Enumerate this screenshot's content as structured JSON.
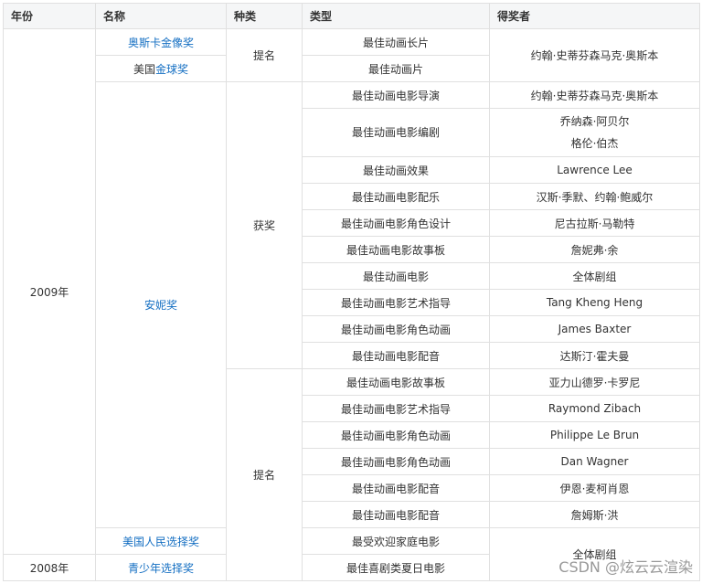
{
  "headers": {
    "year": "年份",
    "name": "名称",
    "kind": "种类",
    "type": "类型",
    "winner": "得奖者"
  },
  "years": {
    "y2009": "2009年",
    "y2008": "2008年"
  },
  "awards": {
    "oscar": "奥斯卡金像奖",
    "golden_globe": "美国金球奖",
    "annie": "安妮奖",
    "peoples_choice": "美国人民选择奖",
    "teen_choice": "青少年选择奖"
  },
  "kinds": {
    "nominated": "提名",
    "won": "获奖"
  },
  "rows": [
    {
      "type": "最佳动画长片"
    },
    {
      "type": "最佳动画片"
    },
    {
      "type": "最佳动画电影导演",
      "winner": "约翰·史蒂芬森马克·奥斯本"
    },
    {
      "type": "最佳动画电影编剧",
      "winner_lines": [
        "乔纳森·阿贝尔",
        "格伦·伯杰"
      ]
    },
    {
      "type": "最佳动画效果",
      "winner": "Lawrence Lee"
    },
    {
      "type": "最佳动画电影配乐",
      "winner": "汉斯·季默、约翰·鲍威尔"
    },
    {
      "type": "最佳动画电影角色设计",
      "winner": "尼古拉斯·马勒特"
    },
    {
      "type": "最佳动画电影故事板",
      "winner": "詹妮弗·余"
    },
    {
      "type": "最佳动画电影",
      "winner": "全体剧组"
    },
    {
      "type": "最佳动画电影艺术指导",
      "winner": "Tang Kheng Heng"
    },
    {
      "type": "最佳动画电影角色动画",
      "winner": "James Baxter"
    },
    {
      "type": "最佳动画电影配音",
      "winner": "达斯汀·霍夫曼"
    },
    {
      "type": "最佳动画电影故事板",
      "winner": "亚力山德罗·卡罗尼"
    },
    {
      "type": "最佳动画电影艺术指导",
      "winner": "Raymond Zibach"
    },
    {
      "type": "最佳动画电影角色动画",
      "winner": "Philippe Le Brun"
    },
    {
      "type": "最佳动画电影角色动画",
      "winner": "Dan Wagner"
    },
    {
      "type": "最佳动画电影配音",
      "winner": "伊恩·麦柯肖恩"
    },
    {
      "type": "最佳动画电影配音",
      "winner": "詹姆斯·洪"
    },
    {
      "type": "最受欢迎家庭电影"
    },
    {
      "type": "最佳喜剧类夏日电影"
    }
  ],
  "merged_winners": {
    "oscar_group": "约翰·史蒂芬森马克·奥斯本",
    "last_group": "全体剧组"
  },
  "watermark": "CSDN @炫云云渲染",
  "colors": {
    "link": "#136ec2",
    "header_bg": "#f5f6f7",
    "border": "#e0e0e0"
  }
}
